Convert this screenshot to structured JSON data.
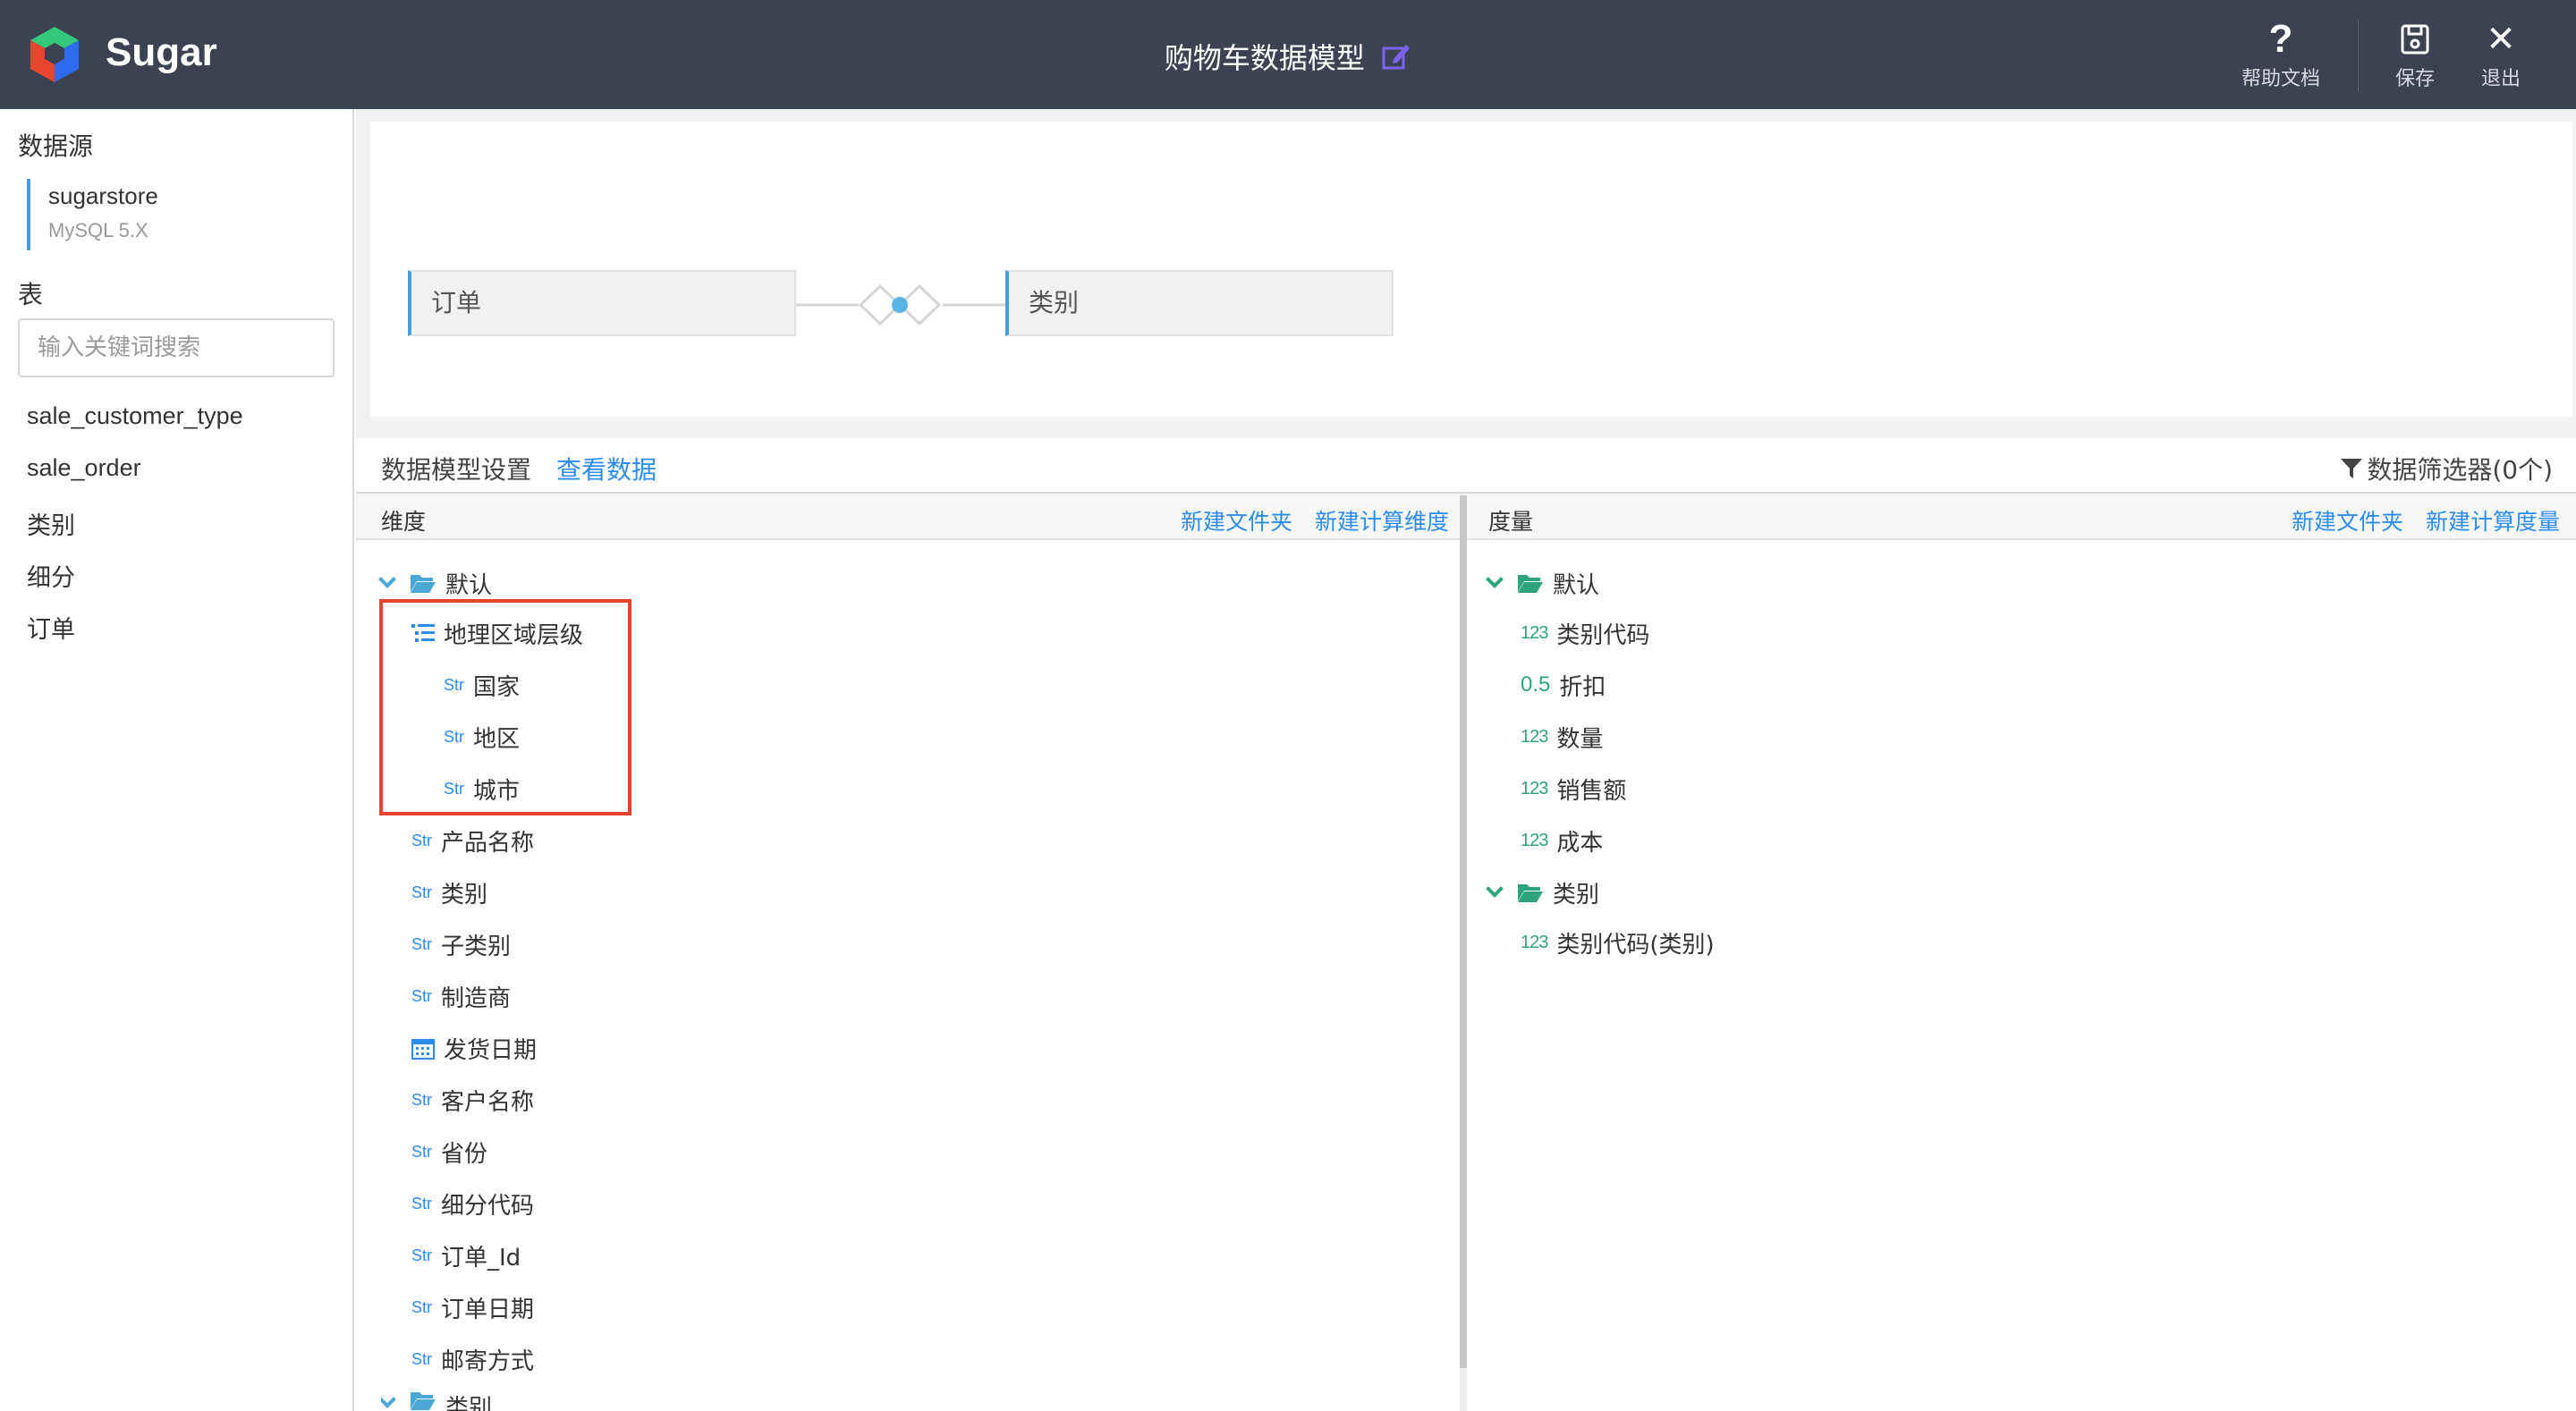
{
  "header": {
    "brand": "Sugar",
    "title": "购物车数据模型",
    "help_label": "帮助文档",
    "save_label": "保存",
    "exit_label": "退出"
  },
  "sidebar": {
    "datasource_title": "数据源",
    "datasource_name": "sugarstore",
    "datasource_type": "MySQL 5.X",
    "table_title": "表",
    "search_placeholder": "输入关键词搜索",
    "tables": [
      "sale_customer_type",
      "sale_order",
      "类别",
      "细分",
      "订单"
    ]
  },
  "canvas": {
    "left_table": "订单",
    "right_table": "类别"
  },
  "settings": {
    "tab_settings": "数据模型设置",
    "tab_view_data": "查看数据",
    "filter_label": "数据筛选器(0个)"
  },
  "dimensions": {
    "title": "维度",
    "new_folder": "新建文件夹",
    "new_calc": "新建计算维度",
    "folder_default": "默认",
    "hierarchy": "地理区域层级",
    "hierarchy_items": [
      "国家",
      "地区",
      "城市"
    ],
    "items": [
      "产品名称",
      "类别",
      "子类别",
      "制造商",
      "发货日期",
      "客户名称",
      "省份",
      "细分代码",
      "订单_Id",
      "订单日期",
      "邮寄方式"
    ],
    "folder_category": "类别",
    "type_str": "Str"
  },
  "measures": {
    "title": "度量",
    "new_folder": "新建文件夹",
    "new_calc": "新建计算度量",
    "folder_default": "默认",
    "items": [
      {
        "type": "123",
        "label": "类别代码"
      },
      {
        "type": "0.5",
        "label": "折扣"
      },
      {
        "type": "123",
        "label": "数量"
      },
      {
        "type": "123",
        "label": "销售额"
      },
      {
        "type": "123",
        "label": "成本"
      }
    ],
    "folder_category": "类别",
    "category_items": [
      {
        "type": "123",
        "label": "类别代码(类别)"
      }
    ]
  },
  "colors": {
    "header_bg": "#3d4253",
    "accent_blue": "#2d8cf0",
    "measure_green": "#2fa37a",
    "highlight_red": "#e8452f"
  }
}
